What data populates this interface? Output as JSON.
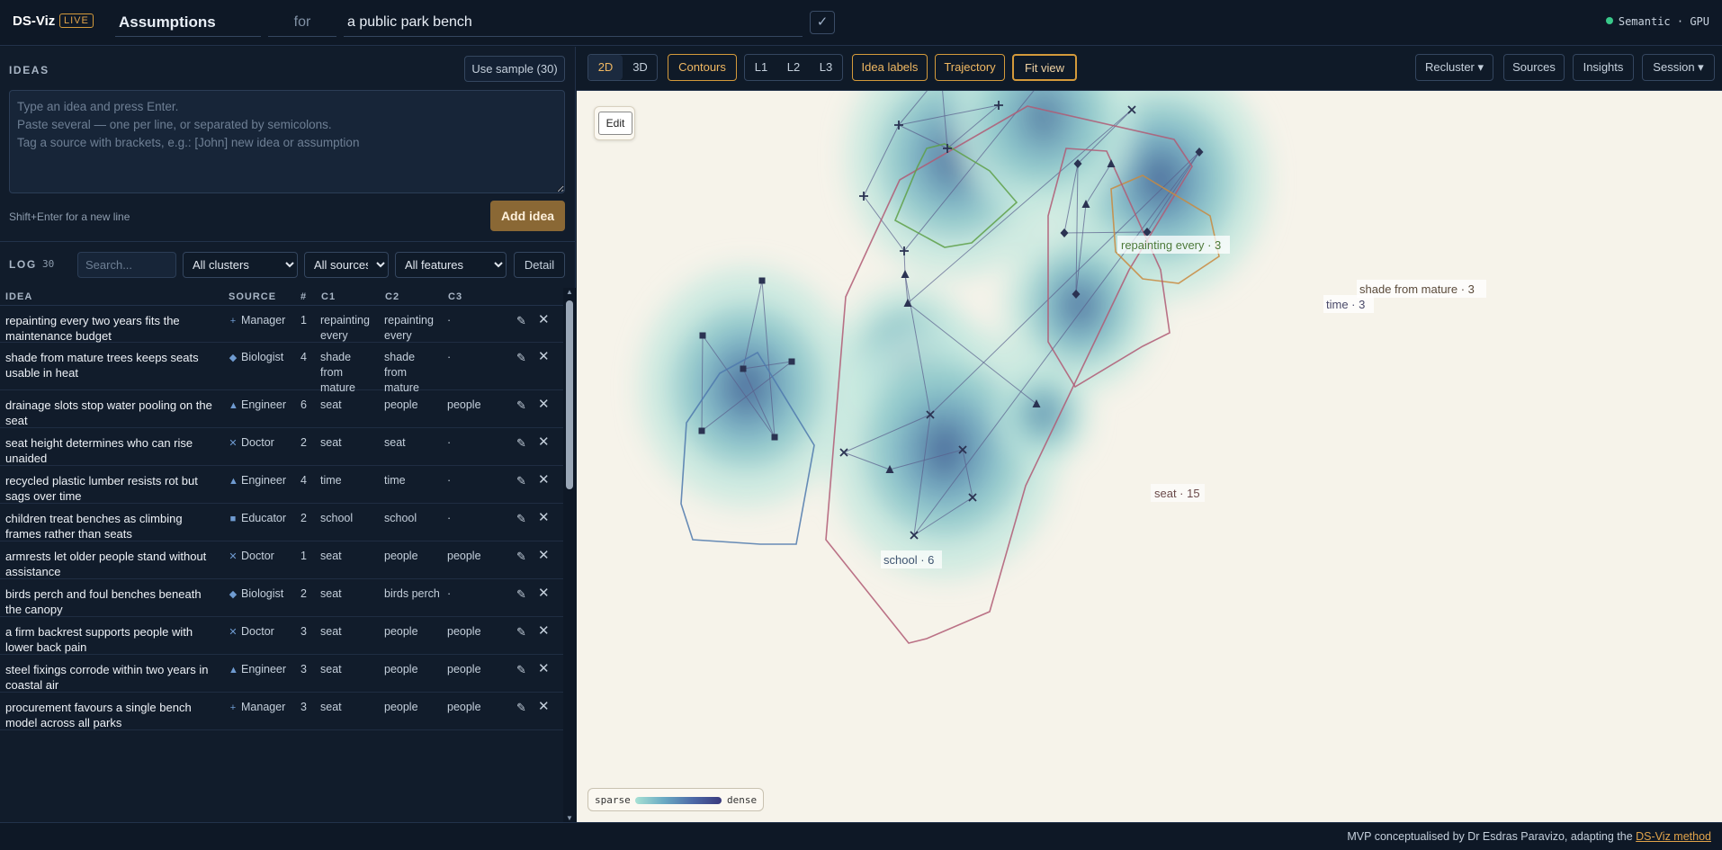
{
  "app": {
    "brand": "DS-Viz",
    "live_badge": "LIVE",
    "title": "Assumptions",
    "for_label": "for",
    "subject": "a public park bench",
    "confirm": "✓",
    "status": "Semantic · GPU"
  },
  "ideas": {
    "heading": "IDEAS",
    "sample_button": "Use sample (30)",
    "placeholder": "Type an idea and press Enter.\nPaste several — one per line, or separated by semicolons.\nTag a source with brackets, e.g.: [John] new idea or assumption",
    "hint": "Shift+Enter for a new line",
    "add_button": "Add idea"
  },
  "log": {
    "heading": "LOG",
    "count": "30",
    "search_placeholder": "Search...",
    "filters": {
      "clusters": "All clusters",
      "sources": "All sources",
      "features": "All features"
    },
    "detail_button": "Detail",
    "columns": {
      "idea": "IDEA",
      "source": "SOURCE",
      "num": "#",
      "c1": "C1",
      "c2": "C2",
      "c3": "C3"
    },
    "rows": [
      {
        "idea": "repainting every two years fits the maintenance budget",
        "source": "Manager",
        "icon": "+",
        "num": "1",
        "c1": "repainting every",
        "c2": "repainting every",
        "c3": "·"
      },
      {
        "idea": "shade from mature trees keeps seats usable in heat",
        "source": "Biologist",
        "icon": "◆",
        "num": "4",
        "c1": "shade from mature",
        "c2": "shade from mature",
        "c3": "·"
      },
      {
        "idea": "drainage slots stop water pooling on the seat",
        "source": "Engineer",
        "icon": "▲",
        "num": "6",
        "c1": "seat",
        "c2": "people",
        "c3": "people"
      },
      {
        "idea": "seat height determines who can rise unaided",
        "source": "Doctor",
        "icon": "✕",
        "num": "2",
        "c1": "seat",
        "c2": "seat",
        "c3": "·"
      },
      {
        "idea": "recycled plastic lumber resists rot but sags over time",
        "source": "Engineer",
        "icon": "▲",
        "num": "4",
        "c1": "time",
        "c2": "time",
        "c3": "·"
      },
      {
        "idea": "children treat benches as climbing frames rather than seats",
        "source": "Educator",
        "icon": "■",
        "num": "2",
        "c1": "school",
        "c2": "school",
        "c3": "·"
      },
      {
        "idea": "armrests let older people stand without assistance",
        "source": "Doctor",
        "icon": "✕",
        "num": "1",
        "c1": "seat",
        "c2": "people",
        "c3": "people"
      },
      {
        "idea": "birds perch and foul benches beneath the canopy",
        "source": "Biologist",
        "icon": "◆",
        "num": "2",
        "c1": "seat",
        "c2": "birds perch",
        "c3": "·"
      },
      {
        "idea": "a firm backrest supports people with lower back pain",
        "source": "Doctor",
        "icon": "✕",
        "num": "3",
        "c1": "seat",
        "c2": "people",
        "c3": "people"
      },
      {
        "idea": "steel fixings corrode within two years in coastal air",
        "source": "Engineer",
        "icon": "▲",
        "num": "3",
        "c1": "seat",
        "c2": "people",
        "c3": "people"
      },
      {
        "idea": "procurement favours a single bench model across all parks",
        "source": "Manager",
        "icon": "+",
        "num": "3",
        "c1": "seat",
        "c2": "people",
        "c3": "people"
      }
    ],
    "edit_icon": "✎",
    "delete_icon": "✕"
  },
  "toolbar": {
    "b2d": "2D",
    "b3d": "3D",
    "contours": "Contours",
    "l1": "L1",
    "l2": "L2",
    "l3": "L3",
    "idea_labels": "Idea labels",
    "trajectory": "Trajectory",
    "fit_view": "Fit view",
    "recluster": "Recluster ▾",
    "sources": "Sources",
    "insights": "Insights",
    "session": "Session ▾"
  },
  "map": {
    "edit": "Edit",
    "labels": {
      "repaint": "repainting every · 3",
      "shade": "shade from mature · 3",
      "time": "time · 3",
      "seat": "seat · 15",
      "school": "school · 6"
    },
    "legend_sparse": "sparse",
    "legend_dense": "dense",
    "colors": {
      "seat_hull": "#b05a74",
      "repaint_hull": "#5ea048",
      "shade_hull": "#c98a3e",
      "time_hull": "#b05a74",
      "school_hull": "#4f79ad"
    }
  },
  "footer": {
    "text": "MVP conceptualised by Dr Esdras Paravizo, adapting the ",
    "link": "DS-Viz method"
  }
}
